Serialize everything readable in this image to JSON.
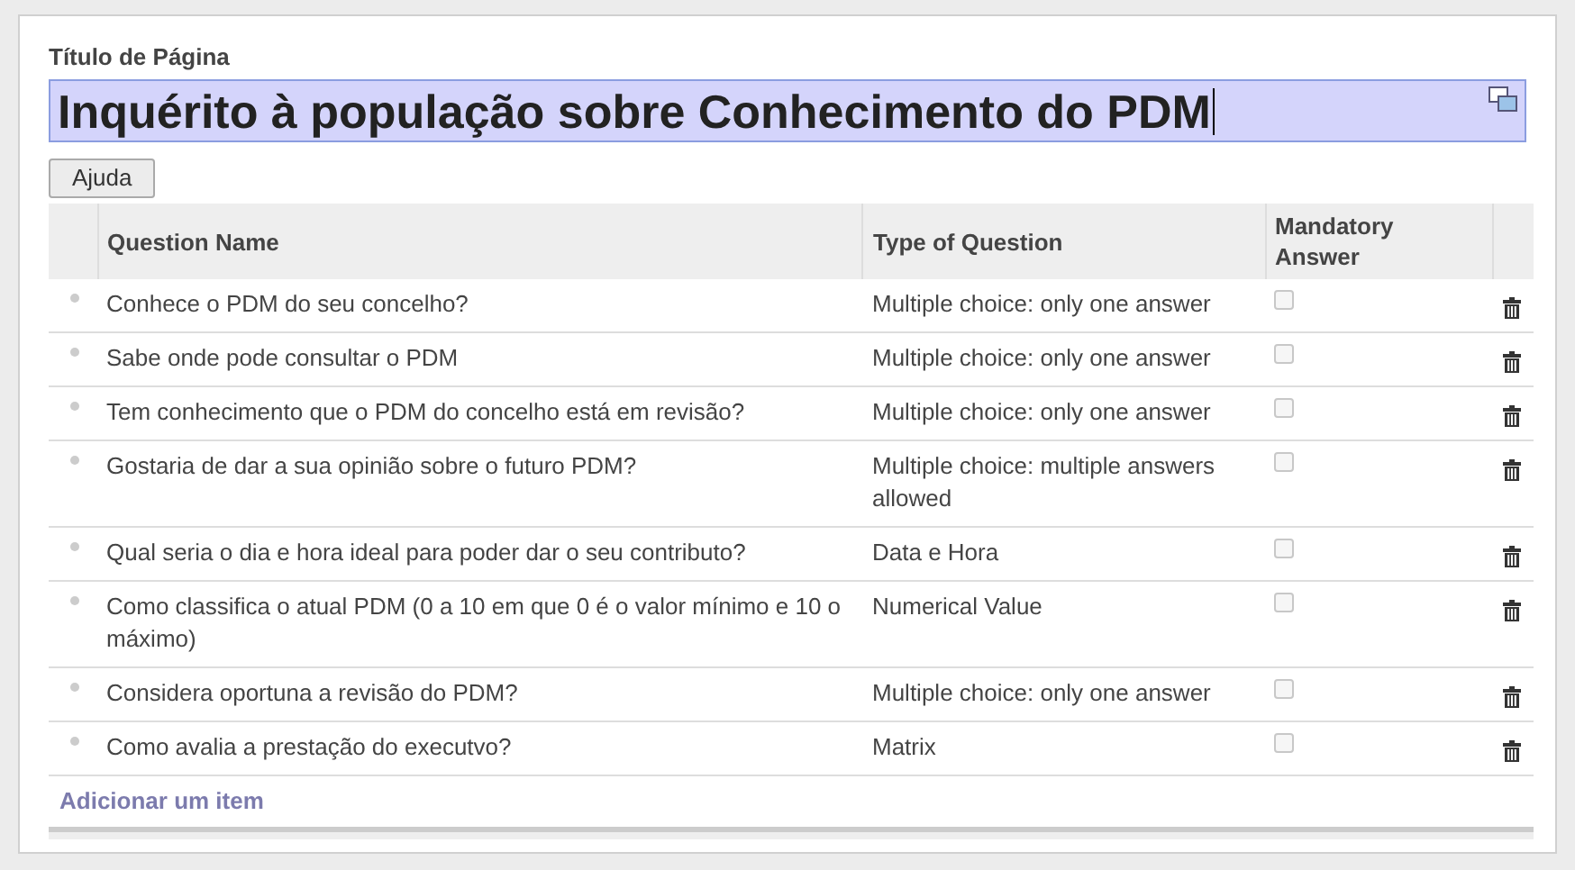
{
  "page_title_label": "Título de Página",
  "page_title": "Inquérito à população sobre Conhecimento do PDM",
  "help_button": "Ajuda",
  "table": {
    "columns": [
      "Question Name",
      "Type of Question",
      "Mandatory Answer"
    ],
    "rows": [
      {
        "name": "Conhece o PDM do seu concelho?",
        "type": "Multiple choice: only one answer",
        "mandatory": false
      },
      {
        "name": "Sabe onde pode consultar o PDM",
        "type": "Multiple choice: only one answer",
        "mandatory": false
      },
      {
        "name": "Tem conhecimento que o PDM do concelho está em revisão?",
        "type": "Multiple choice: only one answer",
        "mandatory": false
      },
      {
        "name": "Gostaria de dar a sua opinião sobre o futuro PDM?",
        "type": "Multiple choice: multiple answers allowed",
        "mandatory": false
      },
      {
        "name": "Qual seria o dia e hora ideal para poder dar o seu contributo?",
        "type": "Data e Hora",
        "mandatory": false
      },
      {
        "name": "Como classifica o atual PDM (0 a 10 em que 0 é o valor mínimo e 10 o máximo)",
        "type": "Numerical Value",
        "mandatory": false
      },
      {
        "name": "Considera oportuna a revisão do PDM?",
        "type": "Multiple choice: only one answer",
        "mandatory": false
      },
      {
        "name": "Como avalia a prestação do executvo?",
        "type": "Matrix",
        "mandatory": false
      }
    ],
    "add_item_link": "Adicionar um item"
  }
}
